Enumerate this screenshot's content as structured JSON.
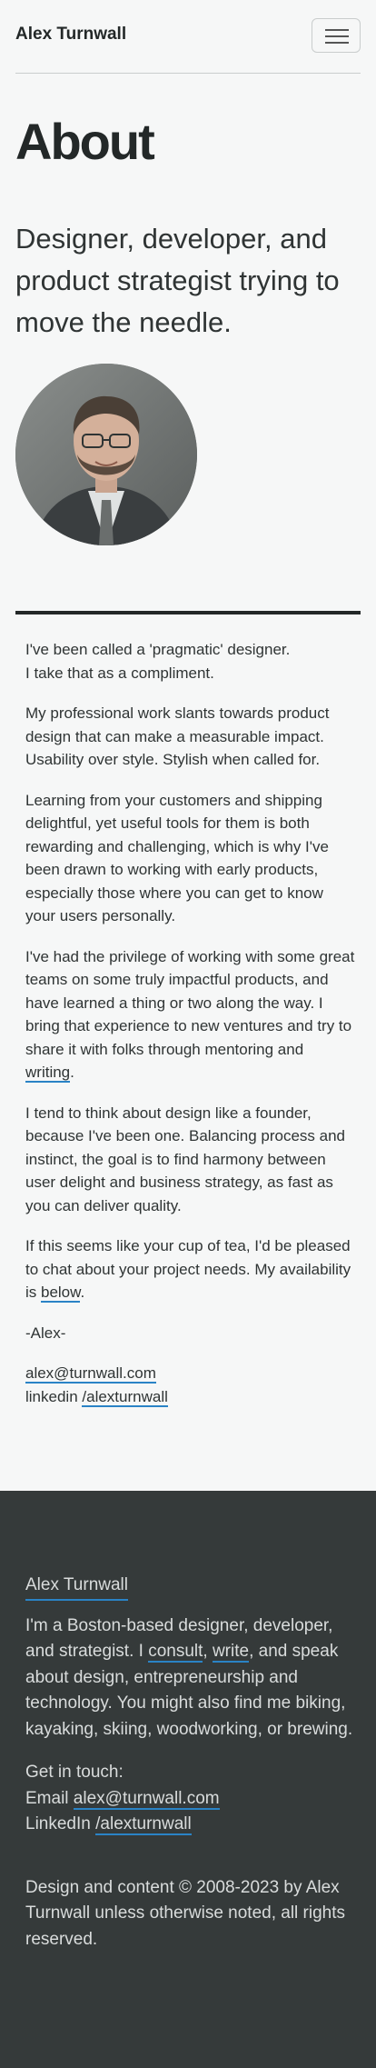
{
  "header": {
    "brand": "Alex Turnwall",
    "menu_icon": "hamburger-icon"
  },
  "hero": {
    "title": "About",
    "tagline": "Designer, developer, and product strategist trying to move the needle."
  },
  "about": {
    "p1a": "I've been called a 'pragmatic' designer.",
    "p1b": "I take that as a compliment.",
    "p2": "My professional work slants towards product design that can make a measurable impact. Usability over style. Stylish when called for.",
    "p3": "Learning from your customers and shipping delightful, yet useful tools for them is both rewarding and challenging, which is why I've been drawn to working with early products, especially those where you can get to know your users personally.",
    "p4_text": "I've had the privilege of working with some great teams on some truly impactful products, and have learned a thing or two along the way. I bring that experience to new ventures and try to share it with folks through mentoring and ",
    "p4_link": "writing",
    "p4_end": ".",
    "p5": "I tend to think about design like a founder, because I've been one. Balancing process and instinct, the goal is to find harmony between user delight and business strategy, as fast as you can deliver quality.",
    "p6_text": "If this seems like your cup of tea, I'd be pleased to chat about your project needs. My availability is ",
    "p6_link": "below",
    "p6_end": ".",
    "signoff": "-Alex-",
    "email": "alex@turnwall.com",
    "linkedin_label": "linkedin",
    "linkedin_link": "/alexturnwall"
  },
  "footer": {
    "brand": "Alex Turnwall",
    "bio_1": "I'm a Boston-based designer, developer, and strategist. I ",
    "bio_consult": "consult",
    "bio_comma": ", ",
    "bio_write": "write",
    "bio_2": ", and speak about design, entrepreneurship and technology. You might also find me biking, kayaking, skiing, woodworking, or brewing.",
    "contact_heading": "Get in touch:",
    "email_label": "Email",
    "email": "alex@turnwall.com",
    "linkedin_label": "LinkedIn",
    "linkedin_link": "/alexturnwall",
    "copyright": "Design and content © 2008-2023 by Alex Turnwall unless otherwise noted, all rights reserved."
  },
  "colors": {
    "link_underline": "#2a83c6",
    "footer_bg": "#353a3a",
    "page_bg": "#f6f7f7"
  }
}
